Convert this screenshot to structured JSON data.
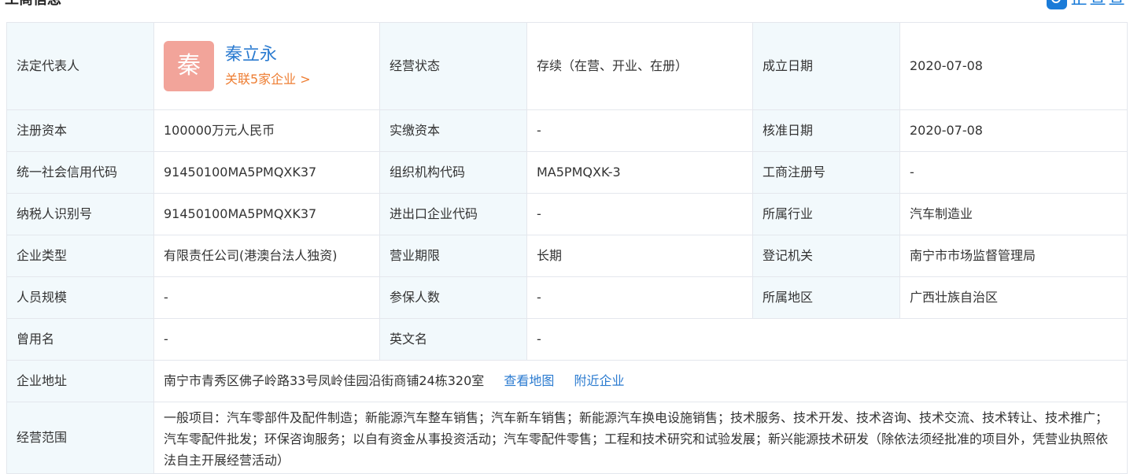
{
  "header": {
    "title": "工商信息",
    "brand": "企查查"
  },
  "legal_rep": {
    "label": "法定代表人",
    "avatar_char": "秦",
    "name": "秦立永",
    "related": "关联5家企业 >"
  },
  "status": {
    "label": "经营状态",
    "value": "存续（在营、开业、在册）"
  },
  "founded": {
    "label": "成立日期",
    "value": "2020-07-08"
  },
  "reg_capital": {
    "label": "注册资本",
    "value": "100000万元人民币"
  },
  "paid_capital": {
    "label": "实缴资本",
    "value": "-"
  },
  "approved_date": {
    "label": "核准日期",
    "value": "2020-07-08"
  },
  "credit_code": {
    "label": "统一社会信用代码",
    "value": "91450100MA5PMQXK37"
  },
  "org_code": {
    "label": "组织机构代码",
    "value": "MA5PMQXK-3"
  },
  "biz_reg_no": {
    "label": "工商注册号",
    "value": "-"
  },
  "tax_id": {
    "label": "纳税人识别号",
    "value": "91450100MA5PMQXK37"
  },
  "import_export": {
    "label": "进出口企业代码",
    "value": "-"
  },
  "industry": {
    "label": "所属行业",
    "value": "汽车制造业"
  },
  "company_type": {
    "label": "企业类型",
    "value": "有限责任公司(港澳台法人独资)"
  },
  "biz_term": {
    "label": "营业期限",
    "value": "长期"
  },
  "reg_authority": {
    "label": "登记机关",
    "value": "南宁市市场监督管理局"
  },
  "staff_size": {
    "label": "人员规模",
    "value": "-"
  },
  "insured_count": {
    "label": "参保人数",
    "value": "-"
  },
  "region": {
    "label": "所属地区",
    "value": "广西壮族自治区"
  },
  "former_name": {
    "label": "曾用名",
    "value": "-"
  },
  "english_name": {
    "label": "英文名",
    "value": "-"
  },
  "address": {
    "label": "企业地址",
    "value": "南宁市青秀区佛子岭路33号凤岭佳园沿街商铺24栋320室",
    "map_link": "查看地图",
    "nearby_link": "附近企业"
  },
  "scope": {
    "label": "经营范围",
    "value": "一般项目：汽车零部件及配件制造；新能源汽车整车销售；汽车新车销售；新能源汽车换电设施销售；技术服务、技术开发、技术咨询、技术交流、技术转让、技术推广；汽车零配件批发；环保咨询服务；以自有资金从事投资活动；汽车零配件零售；工程和技术研究和试验发展；新兴能源技术研发（除依法须经批准的项目外，凭营业执照依法自主开展经营活动）"
  },
  "colors": {
    "label_bg": "#f2f9fc",
    "border": "#e4e7ed",
    "link_blue": "#2b7bd0",
    "link_orange": "#ee7e33",
    "avatar_bg": "#f2a49a"
  }
}
